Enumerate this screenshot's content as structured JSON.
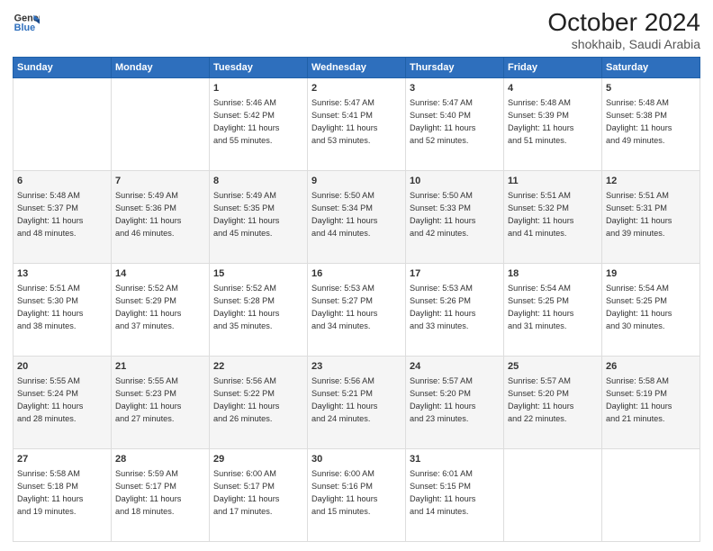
{
  "header": {
    "logo_line1": "General",
    "logo_line2": "Blue",
    "title": "October 2024",
    "subtitle": "shokhaib, Saudi Arabia"
  },
  "days_header": [
    "Sunday",
    "Monday",
    "Tuesday",
    "Wednesday",
    "Thursday",
    "Friday",
    "Saturday"
  ],
  "weeks": [
    [
      {
        "day": "",
        "info": ""
      },
      {
        "day": "",
        "info": ""
      },
      {
        "day": "1",
        "info": "Sunrise: 5:46 AM\nSunset: 5:42 PM\nDaylight: 11 hours\nand 55 minutes."
      },
      {
        "day": "2",
        "info": "Sunrise: 5:47 AM\nSunset: 5:41 PM\nDaylight: 11 hours\nand 53 minutes."
      },
      {
        "day": "3",
        "info": "Sunrise: 5:47 AM\nSunset: 5:40 PM\nDaylight: 11 hours\nand 52 minutes."
      },
      {
        "day": "4",
        "info": "Sunrise: 5:48 AM\nSunset: 5:39 PM\nDaylight: 11 hours\nand 51 minutes."
      },
      {
        "day": "5",
        "info": "Sunrise: 5:48 AM\nSunset: 5:38 PM\nDaylight: 11 hours\nand 49 minutes."
      }
    ],
    [
      {
        "day": "6",
        "info": "Sunrise: 5:48 AM\nSunset: 5:37 PM\nDaylight: 11 hours\nand 48 minutes."
      },
      {
        "day": "7",
        "info": "Sunrise: 5:49 AM\nSunset: 5:36 PM\nDaylight: 11 hours\nand 46 minutes."
      },
      {
        "day": "8",
        "info": "Sunrise: 5:49 AM\nSunset: 5:35 PM\nDaylight: 11 hours\nand 45 minutes."
      },
      {
        "day": "9",
        "info": "Sunrise: 5:50 AM\nSunset: 5:34 PM\nDaylight: 11 hours\nand 44 minutes."
      },
      {
        "day": "10",
        "info": "Sunrise: 5:50 AM\nSunset: 5:33 PM\nDaylight: 11 hours\nand 42 minutes."
      },
      {
        "day": "11",
        "info": "Sunrise: 5:51 AM\nSunset: 5:32 PM\nDaylight: 11 hours\nand 41 minutes."
      },
      {
        "day": "12",
        "info": "Sunrise: 5:51 AM\nSunset: 5:31 PM\nDaylight: 11 hours\nand 39 minutes."
      }
    ],
    [
      {
        "day": "13",
        "info": "Sunrise: 5:51 AM\nSunset: 5:30 PM\nDaylight: 11 hours\nand 38 minutes."
      },
      {
        "day": "14",
        "info": "Sunrise: 5:52 AM\nSunset: 5:29 PM\nDaylight: 11 hours\nand 37 minutes."
      },
      {
        "day": "15",
        "info": "Sunrise: 5:52 AM\nSunset: 5:28 PM\nDaylight: 11 hours\nand 35 minutes."
      },
      {
        "day": "16",
        "info": "Sunrise: 5:53 AM\nSunset: 5:27 PM\nDaylight: 11 hours\nand 34 minutes."
      },
      {
        "day": "17",
        "info": "Sunrise: 5:53 AM\nSunset: 5:26 PM\nDaylight: 11 hours\nand 33 minutes."
      },
      {
        "day": "18",
        "info": "Sunrise: 5:54 AM\nSunset: 5:25 PM\nDaylight: 11 hours\nand 31 minutes."
      },
      {
        "day": "19",
        "info": "Sunrise: 5:54 AM\nSunset: 5:25 PM\nDaylight: 11 hours\nand 30 minutes."
      }
    ],
    [
      {
        "day": "20",
        "info": "Sunrise: 5:55 AM\nSunset: 5:24 PM\nDaylight: 11 hours\nand 28 minutes."
      },
      {
        "day": "21",
        "info": "Sunrise: 5:55 AM\nSunset: 5:23 PM\nDaylight: 11 hours\nand 27 minutes."
      },
      {
        "day": "22",
        "info": "Sunrise: 5:56 AM\nSunset: 5:22 PM\nDaylight: 11 hours\nand 26 minutes."
      },
      {
        "day": "23",
        "info": "Sunrise: 5:56 AM\nSunset: 5:21 PM\nDaylight: 11 hours\nand 24 minutes."
      },
      {
        "day": "24",
        "info": "Sunrise: 5:57 AM\nSunset: 5:20 PM\nDaylight: 11 hours\nand 23 minutes."
      },
      {
        "day": "25",
        "info": "Sunrise: 5:57 AM\nSunset: 5:20 PM\nDaylight: 11 hours\nand 22 minutes."
      },
      {
        "day": "26",
        "info": "Sunrise: 5:58 AM\nSunset: 5:19 PM\nDaylight: 11 hours\nand 21 minutes."
      }
    ],
    [
      {
        "day": "27",
        "info": "Sunrise: 5:58 AM\nSunset: 5:18 PM\nDaylight: 11 hours\nand 19 minutes."
      },
      {
        "day": "28",
        "info": "Sunrise: 5:59 AM\nSunset: 5:17 PM\nDaylight: 11 hours\nand 18 minutes."
      },
      {
        "day": "29",
        "info": "Sunrise: 6:00 AM\nSunset: 5:17 PM\nDaylight: 11 hours\nand 17 minutes."
      },
      {
        "day": "30",
        "info": "Sunrise: 6:00 AM\nSunset: 5:16 PM\nDaylight: 11 hours\nand 15 minutes."
      },
      {
        "day": "31",
        "info": "Sunrise: 6:01 AM\nSunset: 5:15 PM\nDaylight: 11 hours\nand 14 minutes."
      },
      {
        "day": "",
        "info": ""
      },
      {
        "day": "",
        "info": ""
      }
    ]
  ]
}
